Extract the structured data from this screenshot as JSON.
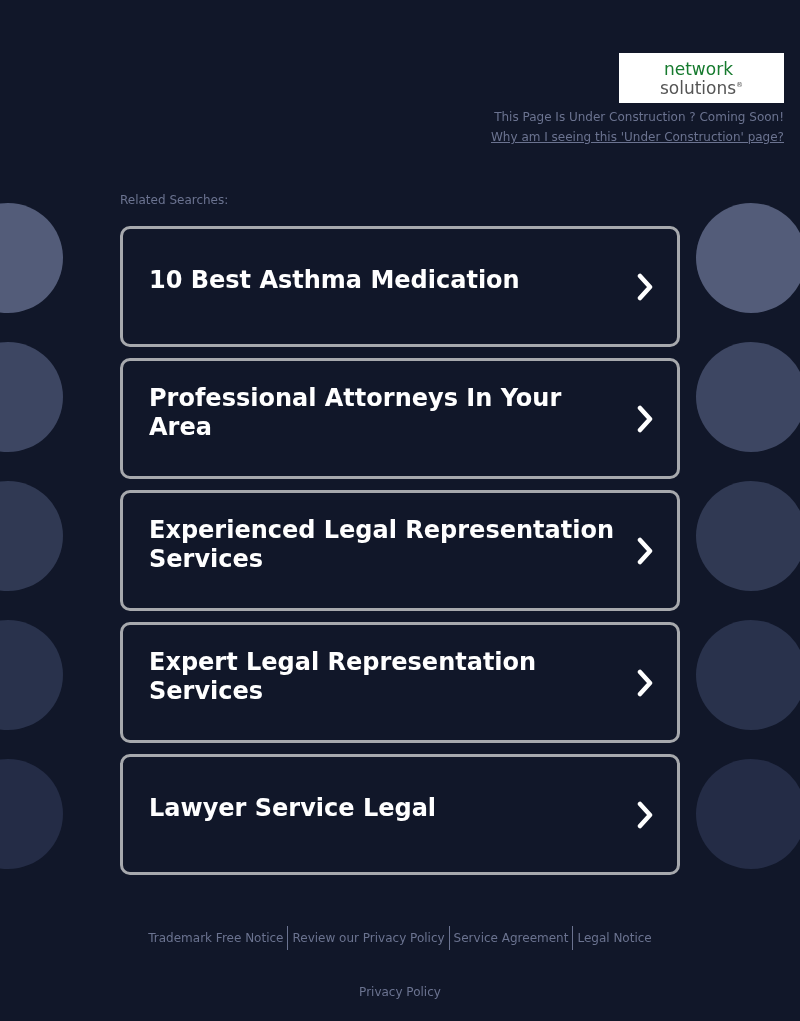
{
  "logo": {
    "line1": "network",
    "line2": "solutions$^{®}$"
  },
  "notice": "This Page Is Under Construction ? Coming Soon!",
  "why_link": "Why am I seeing this 'Under Construction' page?",
  "related_label": "Related Searches:",
  "searches": [
    {
      "label": "10 Best Asthma Medication"
    },
    {
      "label": "Professional Attorneys In Your Area"
    },
    {
      "label": "Experienced Legal Representation Services"
    },
    {
      "label": "Expert Legal Representation Services"
    },
    {
      "label": "Lawyer Service Legal"
    }
  ],
  "footer_links": [
    "Trademark Free Notice",
    "Review our Privacy Policy",
    "Service Agreement",
    "Legal Notice"
  ],
  "privacy_policy": "Privacy Policy"
}
